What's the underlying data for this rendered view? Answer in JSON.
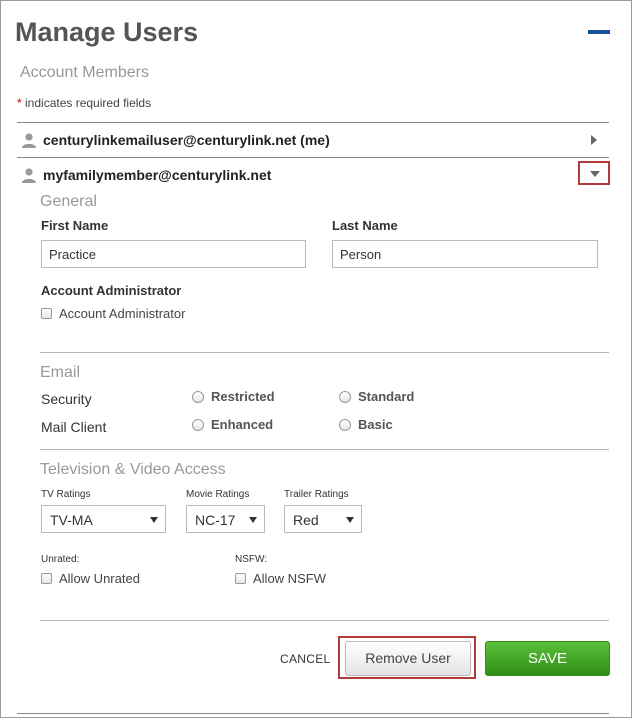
{
  "page": {
    "title": "Manage Users",
    "subtitle": "Account Members",
    "required_note_star": "*",
    "required_note": "indicates required fields",
    "accent_color": "#1a4f9c"
  },
  "users": [
    {
      "email": "centurylinkemailuser@centurylink.net (me)",
      "icon": "user-icon",
      "state": "collapsed"
    },
    {
      "email": "myfamilymember@centurylink.net",
      "icon": "user-icon",
      "state": "expanded"
    }
  ],
  "general": {
    "heading": "General",
    "first_name_label": "First Name",
    "first_name_value": "Practice",
    "last_name_label": "Last Name",
    "last_name_value": "Person",
    "admin_heading": "Account Administrator",
    "admin_checkbox_label": "Account Administrator"
  },
  "email": {
    "heading": "Email",
    "security_label": "Security",
    "security_options": [
      "Restricted",
      "Standard"
    ],
    "mail_client_label": "Mail Client",
    "mail_client_options": [
      "Enhanced",
      "Basic"
    ]
  },
  "tv": {
    "heading": "Television & Video Access",
    "tv_ratings_label": "TV Ratings",
    "tv_ratings_value": "TV-MA",
    "movie_ratings_label": "Movie Ratings",
    "movie_ratings_value": "NC-17",
    "trailer_ratings_label": "Trailer Ratings",
    "trailer_ratings_value": "Red",
    "unrated_label": "Unrated:",
    "unrated_checkbox": "Allow Unrated",
    "nsfw_label": "NSFW:",
    "nsfw_checkbox": "Allow NSFW"
  },
  "actions": {
    "cancel": "CANCEL",
    "remove": "Remove User",
    "save": "SAVE",
    "save_color": "#3fa322",
    "highlight_color": "#b43a3a"
  }
}
